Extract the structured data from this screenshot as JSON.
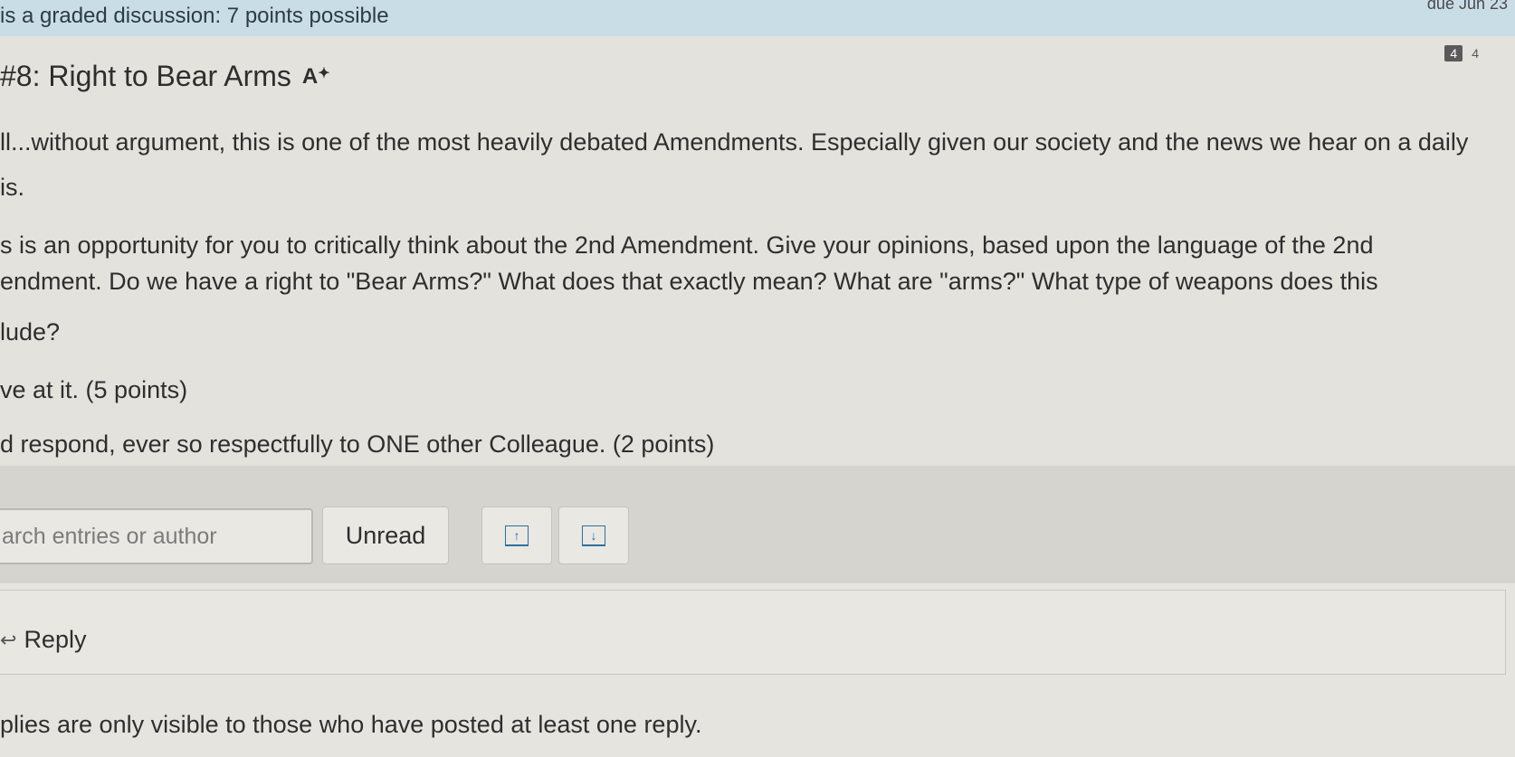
{
  "banner": {
    "graded_text": "is a graded discussion: 7 points possible",
    "due_text": "due Jun 23"
  },
  "discussion": {
    "title": "#8: Right to Bear Arms",
    "subscribe_icon": "text-size-icon",
    "badge": "4",
    "badge_count": "4",
    "paragraphs": [
      "ll...without argument, this is one of the most heavily debated Amendments.  Especially given our society and the news we hear on a daily",
      "is.",
      "s is an opportunity for you to critically think about the 2nd Amendment.  Give your opinions, based upon the language of the 2nd",
      "endment.  Do we have a right to \"Bear Arms?\"  What does that exactly mean?  What are \"arms?\"  What type of weapons does this",
      "lude?",
      "ve at it.  (5 points)",
      "d respond, ever so respectfully to ONE other Colleague.  (2 points)"
    ]
  },
  "toolbar": {
    "search_placeholder": "arch entries or author",
    "unread_label": "Unread",
    "expand_icon": "↑",
    "collapse_icon": "↓"
  },
  "reply": {
    "label": "Reply",
    "icon": "reply-icon"
  },
  "footer": {
    "note": "plies are only visible to those who have posted at least one reply."
  }
}
